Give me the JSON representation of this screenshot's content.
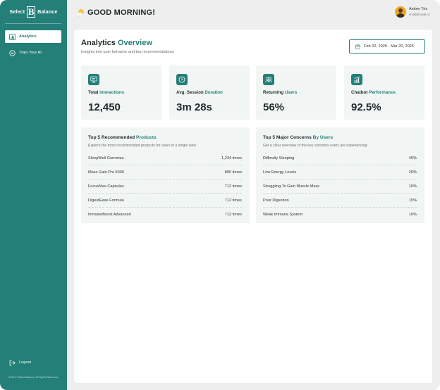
{
  "brand": {
    "left": "Select",
    "mark": "B",
    "right": "Balance"
  },
  "sidebar": {
    "items": [
      {
        "label": "Analytics",
        "icon": "bar-chart-icon",
        "active": true
      },
      {
        "label": "Train Your AI",
        "icon": "ai-chip-icon",
        "active": false
      }
    ],
    "logout": "Logout",
    "footer": "2025 © Select Balance. All Rights Reserved."
  },
  "header": {
    "greeting": "GOOD MORNING!",
    "greeting_icon": "sun-cloud-icon",
    "user_name": "Amber Tris",
    "user_email": "email@email.co"
  },
  "page": {
    "title_main": "Analytics",
    "title_accent": "Overview",
    "subtitle": "Insights into user behavior and top recommendations",
    "date_range": "Feb 02, 2025 - Mar 20, 2025"
  },
  "stats": [
    {
      "label_main": "Total",
      "label_accent": "Interactions",
      "value": "12,450",
      "icon": "chat-monitor-icon"
    },
    {
      "label_main": "Avg. Session",
      "label_accent": "Duration",
      "value": "3m 28s",
      "icon": "clock-icon"
    },
    {
      "label_main": "Returning",
      "label_accent": "Users",
      "value": "56%",
      "icon": "users-icon"
    },
    {
      "label_main": "Chatbot",
      "label_accent": "Performance",
      "value": "92.5%",
      "icon": "growth-chart-icon"
    }
  ],
  "products": {
    "title_main": "Top 5 Recommended",
    "title_accent": "Products",
    "subtitle": "Explore the most recommended products for users in a single view",
    "rows": [
      {
        "name": "SleepWell Gummies",
        "value": "1,234 times"
      },
      {
        "name": "Mass Gain Pro 5000",
        "value": "890 times"
      },
      {
        "name": "FocusMax Capsules",
        "value": "712 times"
      },
      {
        "name": "DigestEase Formula",
        "value": "712 times"
      },
      {
        "name": "ImmuneBoost Advanced",
        "value": "712 times"
      }
    ]
  },
  "concerns": {
    "title_main": "Top 5 Major Concerns",
    "title_accent": "By Users",
    "subtitle": "Get a clear overview of the key concerns users are experiencing",
    "rows": [
      {
        "name": "Difficulty Sleeping",
        "value": "45%"
      },
      {
        "name": "Low Energy Levels",
        "value": "20%"
      },
      {
        "name": "Struggling To Gain Muscle Mass",
        "value": "10%"
      },
      {
        "name": "Poor Digestion",
        "value": "15%"
      },
      {
        "name": "Weak Immune System",
        "value": "10%"
      }
    ]
  },
  "colors": {
    "brand": "#237f78",
    "panel": "#f1f6f5",
    "background": "#eeeeee"
  }
}
